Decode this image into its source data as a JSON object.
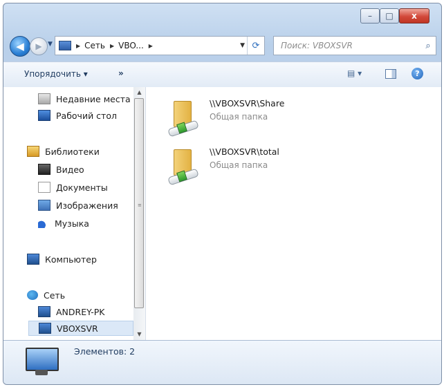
{
  "window": {
    "controls": {
      "minimize": "–",
      "maximize": "□",
      "close": "x"
    }
  },
  "navigation": {
    "back_icon": "arrow-left-icon",
    "forward_icon": "arrow-right-icon",
    "breadcrumb": [
      "Сеть",
      "VBO..."
    ],
    "search_placeholder": "Поиск: VBOXSVR"
  },
  "toolbar": {
    "organize_label": "Упорядочить ▾",
    "more_label": "»"
  },
  "sidebar": {
    "items": [
      {
        "label": "Недавние места",
        "icon": "recent-places-icon"
      },
      {
        "label": "Рабочий стол",
        "icon": "desktop-icon"
      },
      {
        "label": "Библиотеки",
        "icon": "libraries-icon"
      },
      {
        "label": "Видео",
        "icon": "video-icon"
      },
      {
        "label": "Документы",
        "icon": "documents-icon"
      },
      {
        "label": "Изображения",
        "icon": "pictures-icon"
      },
      {
        "label": "Музыка",
        "icon": "music-icon"
      },
      {
        "label": "Компьютер",
        "icon": "computer-icon"
      },
      {
        "label": "Сеть",
        "icon": "network-icon"
      },
      {
        "label": "ANDREY-PK",
        "icon": "network-computer-icon"
      },
      {
        "label": "VBOXSVR",
        "icon": "network-computer-icon",
        "selected": true
      }
    ]
  },
  "content": {
    "items": [
      {
        "name": "\\\\VBOXSVR\\Share",
        "type": "Общая папка"
      },
      {
        "name": "\\\\VBOXSVR\\total",
        "type": "Общая папка"
      }
    ]
  },
  "details": {
    "count_text": "Элементов: 2"
  }
}
